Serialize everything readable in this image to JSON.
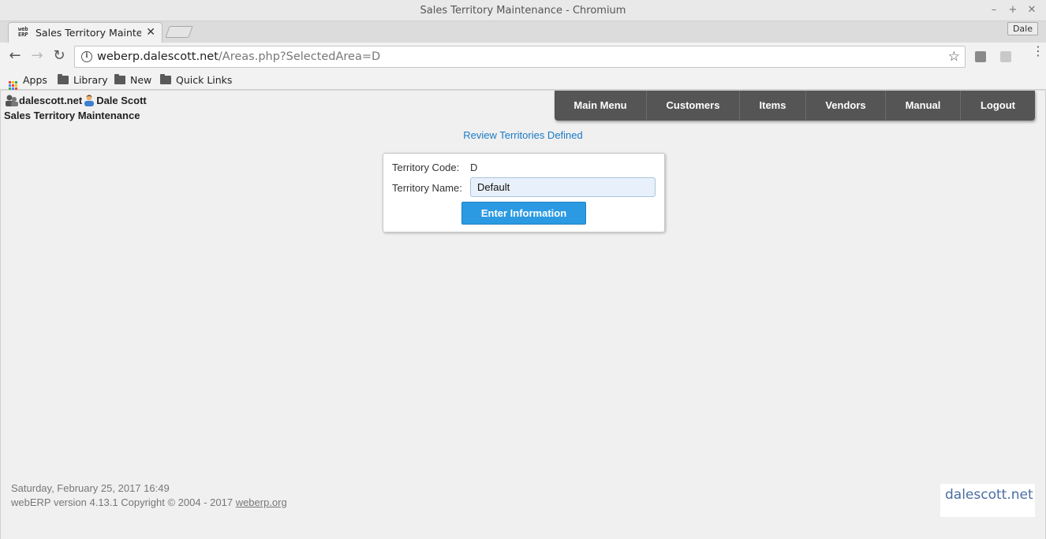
{
  "window": {
    "title": "Sales Territory Maintenance - Chromium",
    "minimize": "–",
    "maximize": "+",
    "close": "✕"
  },
  "tabs": [
    {
      "label": "Sales Territory Maintenance",
      "favicon_text": "web ERP",
      "close": "✕"
    }
  ],
  "profile": "Dale",
  "toolbar": {
    "back": "←",
    "forward": "→",
    "reload": "↻",
    "url_host": "weberp.dalescott.net",
    "url_path": "/Areas.php?SelectedArea=D",
    "star": "☆",
    "menu": "⋮"
  },
  "bookmarks": [
    {
      "label": "Apps",
      "icon": "apps-icon"
    },
    {
      "label": "Library",
      "icon": "folder-icon"
    },
    {
      "label": "New",
      "icon": "folder-icon"
    },
    {
      "label": "Quick Links",
      "icon": "folder-icon"
    }
  ],
  "header": {
    "company": "dalescott.net",
    "user": "Dale Scott",
    "page_title": "Sales Territory Maintenance"
  },
  "mainnav": [
    "Main Menu",
    "Customers",
    "Items",
    "Vendors",
    "Manual",
    "Logout"
  ],
  "review_link": "Review Territories Defined",
  "form": {
    "code_label": "Territory Code:",
    "code_value": "D",
    "name_label": "Territory Name:",
    "name_value": "Default",
    "submit_label": "Enter Information"
  },
  "footer": {
    "datetime": "Saturday, February 25, 2017 16:49",
    "version": "webERP version 4.13.1 Copyright © 2004 - 2017 ",
    "version_link": "weberp.org",
    "logo": "dalescott.net"
  },
  "colors": {
    "nav_bg": "#555555",
    "link": "#1a7ac4",
    "button": "#2b9ae2",
    "input_bg": "#e8f1fb"
  }
}
